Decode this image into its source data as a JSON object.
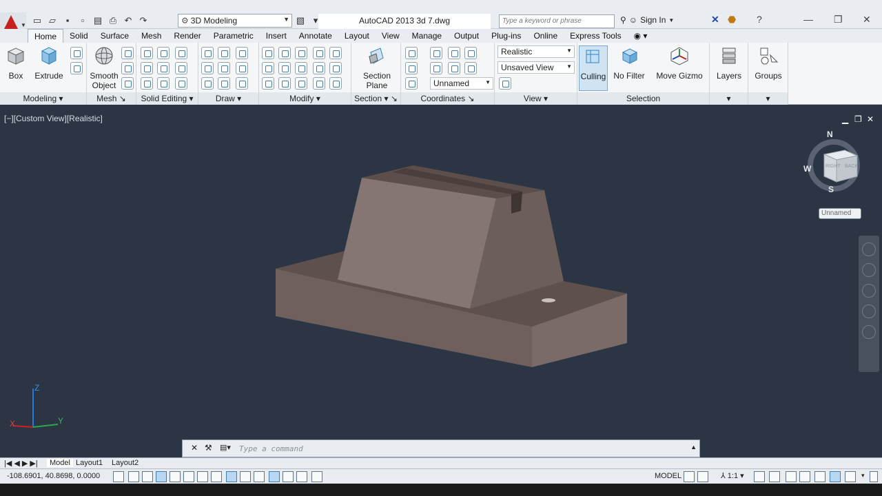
{
  "window": {
    "title": "AutoCAD 2013    3d 7.dwg",
    "workspace": "3D Modeling",
    "search_placeholder": "Type a keyword or phrase",
    "signin": "Sign In"
  },
  "tabs": [
    "Home",
    "Solid",
    "Surface",
    "Mesh",
    "Render",
    "Parametric",
    "Insert",
    "Annotate",
    "Layout",
    "View",
    "Manage",
    "Output",
    "Plug-ins",
    "Online",
    "Express Tools"
  ],
  "ribbon": {
    "box_label": "Box",
    "extrude_label": "Extrude",
    "smooth_label": "Smooth",
    "smooth_label2": "Object",
    "section_label": "Section",
    "section_label2": "Plane",
    "visual_style": "Realistic",
    "view_state": "Unsaved View",
    "ucs_name": "Unnamed",
    "culling_label": "Culling",
    "nofilter_label": "No Filter",
    "gizmo_label": "Move Gizmo",
    "layers_label": "Layers",
    "groups_label": "Groups",
    "panels": {
      "modeling": "Modeling",
      "mesh": "Mesh",
      "solid_editing": "Solid Editing",
      "draw": "Draw",
      "modify": "Modify",
      "section": "Section",
      "coordinates": "Coordinates",
      "view": "View",
      "selection": "Selection"
    }
  },
  "viewport": {
    "label": "[−][Custom View][Realistic]",
    "viewcube": {
      "n": "N",
      "s": "S",
      "w": "W",
      "right": "RIGHT",
      "back": "BACK"
    },
    "ucs_chip": "Unnamed",
    "axis": {
      "x": "X",
      "y": "Y",
      "z": "Z"
    }
  },
  "command": {
    "placeholder": "Type a command"
  },
  "layout_tabs": [
    "Model",
    "Layout1",
    "Layout2"
  ],
  "status": {
    "coords": "-108.6901, 40.8698, 0.0000",
    "model": "MODEL",
    "scale": "1:1"
  },
  "colors": {
    "viewport_bg": "#2b3544",
    "solid_top": "#7d6f6c",
    "solid_front": "#6e5f5c",
    "solid_light": "#8a7b78",
    "logo_red": "#c8201e"
  }
}
